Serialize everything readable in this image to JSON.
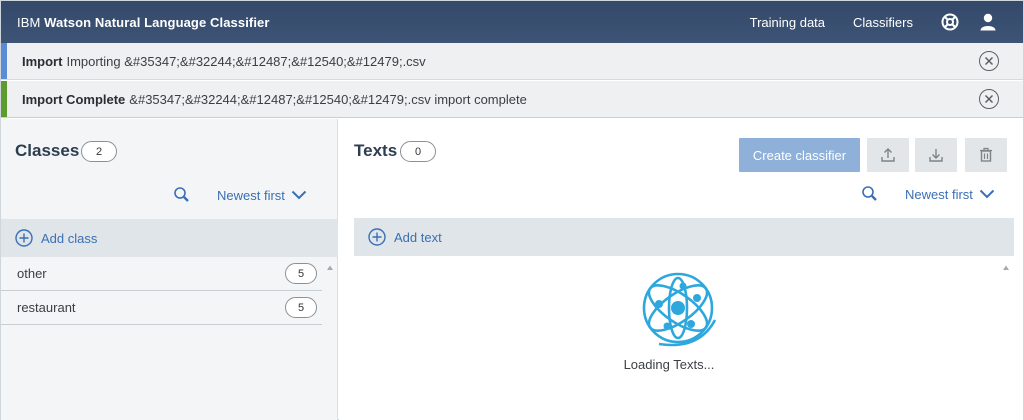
{
  "header": {
    "brand_ibm": "IBM",
    "brand_product": "Watson Natural Language Classifier",
    "nav_training": "Training data",
    "nav_classifiers": "Classifiers",
    "icons": [
      "help-icon",
      "user-icon"
    ]
  },
  "notifications": [
    {
      "title": "Import",
      "message": "Importing &#35347;&#32244;&#12487;&#12540;&#12479;.csv",
      "accent": "#5b8bd6"
    },
    {
      "title": "Import Complete",
      "message": "&#35347;&#32244;&#12487;&#12540;&#12479;.csv import complete",
      "accent": "#5c9c2e"
    }
  ],
  "classes_panel": {
    "title": "Classes",
    "count": "2",
    "sort_label": "Newest first",
    "add_label": "Add class",
    "items": [
      {
        "label": "other",
        "count": "5"
      },
      {
        "label": "restaurant",
        "count": "5"
      }
    ]
  },
  "texts_panel": {
    "title": "Texts",
    "count": "0",
    "create_button": "Create classifier",
    "sort_label": "Newest first",
    "add_label": "Add text",
    "loading": "Loading Texts..."
  },
  "colors": {
    "header_bg": "#3a4f6e",
    "link": "#3b6fb6",
    "create_button_bg": "#8fb0d9",
    "loader": "#2ea8dc"
  }
}
